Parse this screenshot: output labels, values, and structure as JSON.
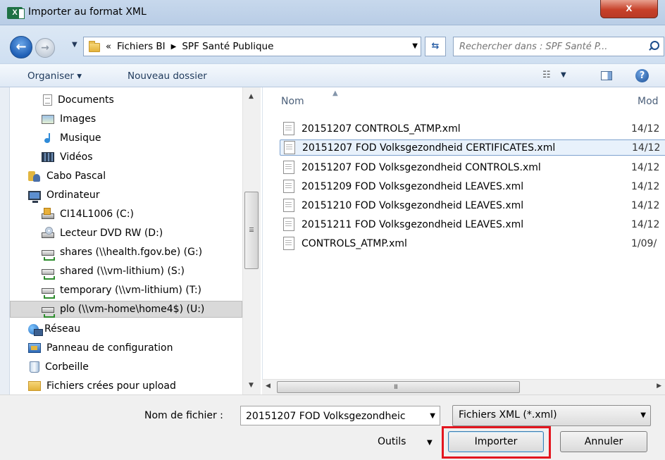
{
  "window": {
    "title": "Importer au format XML",
    "app_icon_text": "X",
    "close_symbol": "x"
  },
  "address": {
    "back_symbol": "←",
    "forward_symbol": "→",
    "prefix": "«",
    "crumbs": [
      "Fichiers BI",
      "SPF Santé Publique"
    ],
    "refresh_symbol": "⇆",
    "search_placeholder": "Rechercher dans : SPF Santé P..."
  },
  "toolbar": {
    "organize_label": "Organiser ▾",
    "new_folder_label": "Nouveau dossier",
    "help_symbol": "?"
  },
  "nav": {
    "items": [
      {
        "label": "Documents",
        "icon": "documents-icon"
      },
      {
        "label": "Images",
        "icon": "images-icon"
      },
      {
        "label": "Musique",
        "icon": "music-icon"
      },
      {
        "label": "Vidéos",
        "icon": "videos-icon"
      },
      {
        "label": "Cabo Pascal",
        "icon": "user-folder-icon"
      },
      {
        "label": "Ordinateur",
        "icon": "computer-icon"
      },
      {
        "label": "CI14L1006 (C:)",
        "icon": "local-drive-icon"
      },
      {
        "label": "Lecteur DVD RW (D:)",
        "icon": "dvd-drive-icon"
      },
      {
        "label": "shares (\\\\health.fgov.be) (G:)",
        "icon": "network-drive-icon"
      },
      {
        "label": "shared (\\\\vm-lithium) (S:)",
        "icon": "network-drive-icon"
      },
      {
        "label": "temporary (\\\\vm-lithium) (T:)",
        "icon": "network-drive-icon"
      },
      {
        "label": "plo (\\\\vm-home\\home4$) (U:)",
        "icon": "network-drive-icon",
        "selected": true
      },
      {
        "label": "Réseau",
        "icon": "network-icon"
      },
      {
        "label": "Panneau de configuration",
        "icon": "control-panel-icon"
      },
      {
        "label": "Corbeille",
        "icon": "recycle-bin-icon"
      },
      {
        "label": "Fichiers crées pour upload",
        "icon": "folder-icon"
      }
    ]
  },
  "files": {
    "columns": {
      "name": "Nom",
      "modified": "Mod"
    },
    "rows": [
      {
        "name": "20151207 CONTROLS_ATMP.xml",
        "date": "14/12"
      },
      {
        "name": "20151207 FOD Volksgezondheid CERTIFICATES.xml",
        "date": "14/12",
        "selected": true
      },
      {
        "name": "20151207 FOD Volksgezondheid CONTROLS.xml",
        "date": "14/12"
      },
      {
        "name": "20151209 FOD Volksgezondheid LEAVES.xml",
        "date": "14/12"
      },
      {
        "name": "20151210 FOD Volksgezondheid LEAVES.xml",
        "date": "14/12"
      },
      {
        "name": "20151211 FOD Volksgezondheid LEAVES.xml",
        "date": "14/12"
      },
      {
        "name": "CONTROLS_ATMP.xml",
        "date": "1/09/"
      }
    ],
    "h_scroll_grip": "III"
  },
  "footer": {
    "filename_label": "Nom de fichier :",
    "filename_value": "20151207 FOD Volksgezondheic",
    "filetype_value": "Fichiers XML (*.xml)",
    "tools_label": "Outils",
    "import_label": "Importer",
    "cancel_label": "Annuler"
  },
  "colors": {
    "highlight": "#e3161f",
    "selection": "#e8f1fb"
  }
}
